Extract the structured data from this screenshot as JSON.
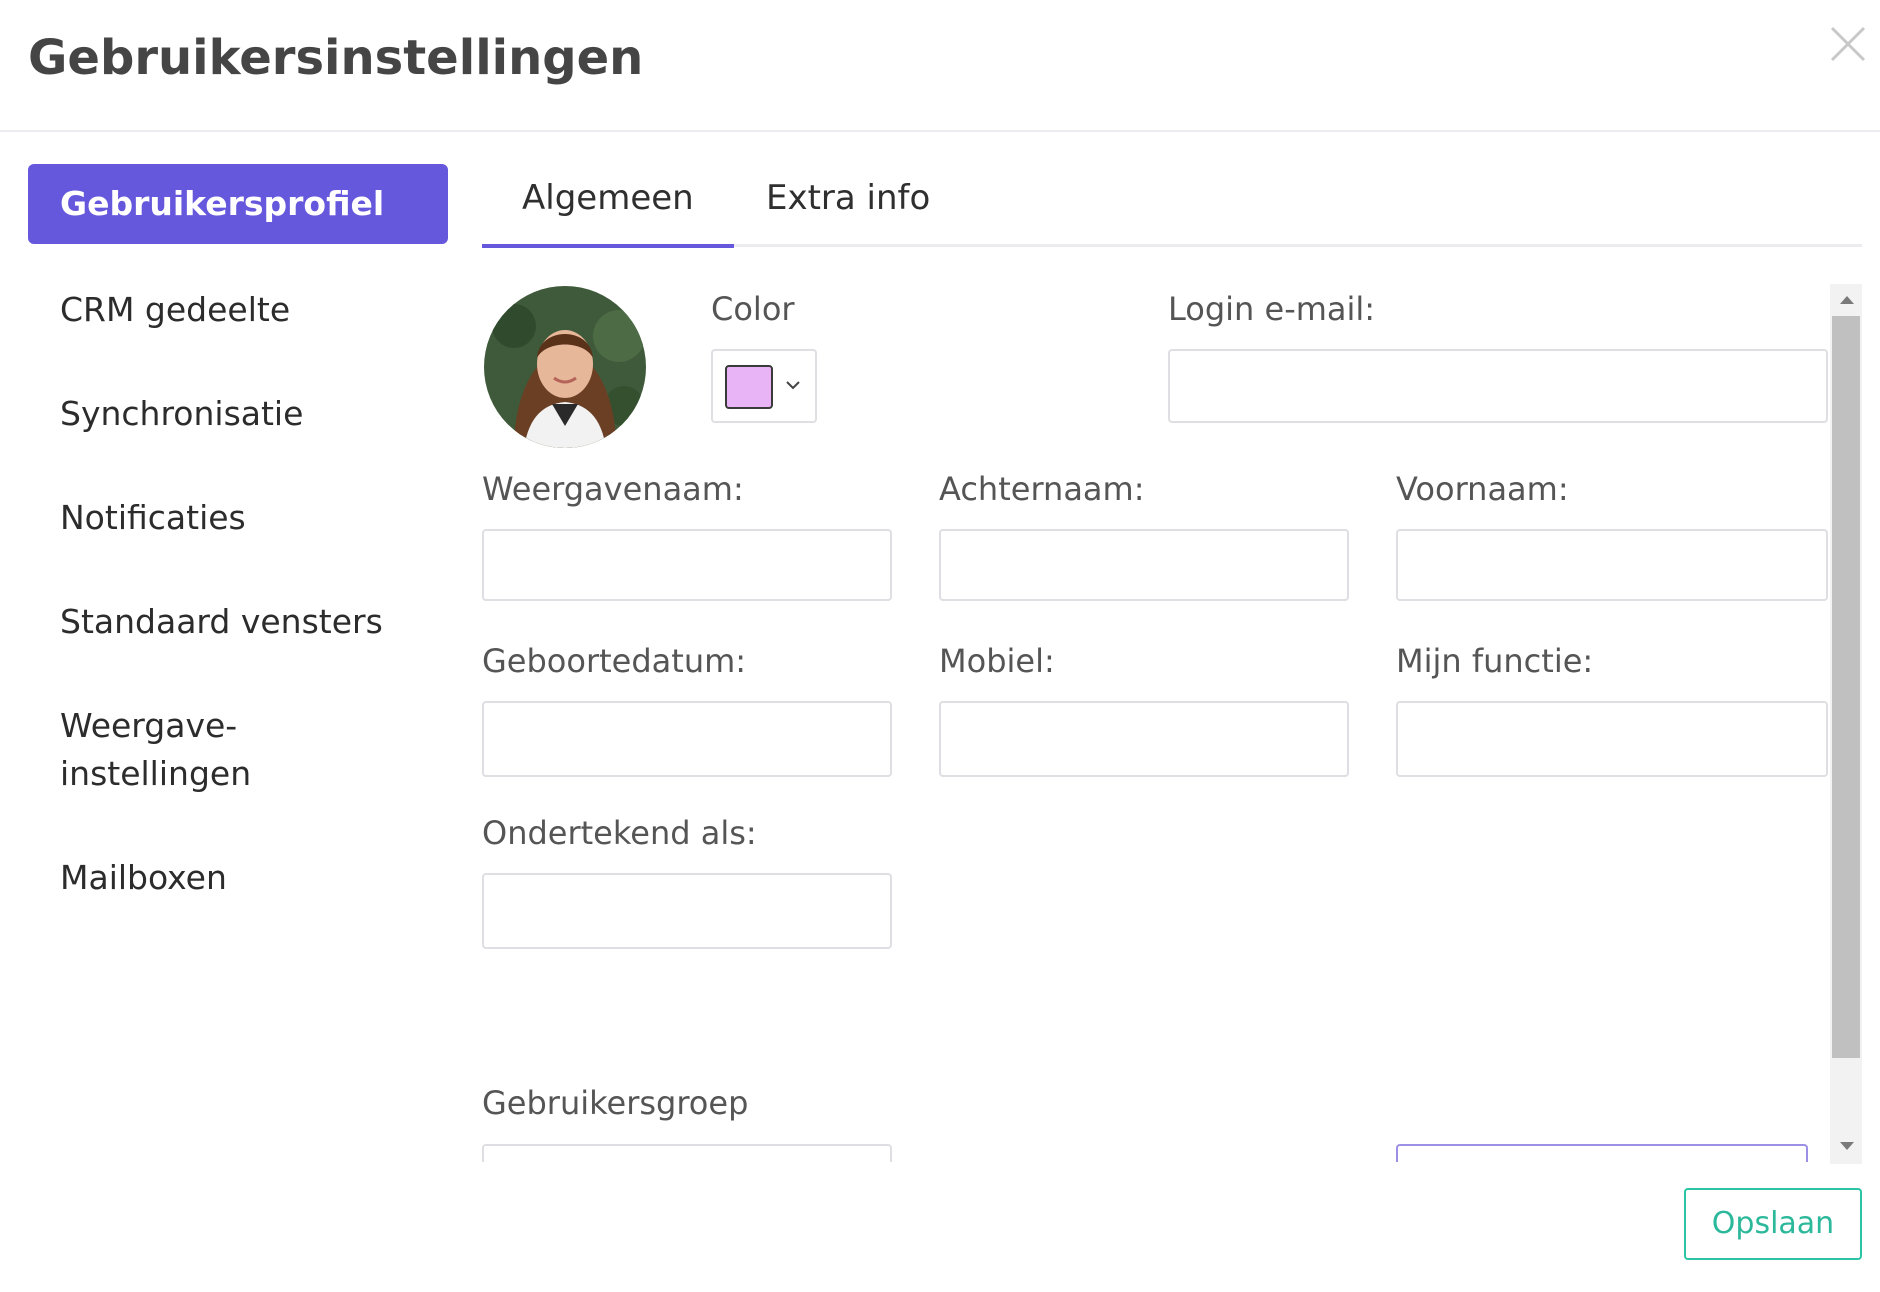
{
  "dialog": {
    "title": "Gebruikersinstellingen"
  },
  "sidebar": {
    "items": [
      {
        "label": "Gebruikersprofiel",
        "active": true
      },
      {
        "label": "CRM gedeelte"
      },
      {
        "label": "Synchronisatie"
      },
      {
        "label": "Notificaties"
      },
      {
        "label": "Standaard vensters"
      },
      {
        "label": "Weergave-\ninstellingen"
      },
      {
        "label": "Mailboxen"
      }
    ]
  },
  "tabs": [
    {
      "label": "Algemeen",
      "active": true
    },
    {
      "label": "Extra info"
    }
  ],
  "form": {
    "color_label": "Color",
    "color_value": "#e9b4f5",
    "login_email_label": "Login e-mail:",
    "login_email_value": "",
    "weergavenaam_label": "Weergavenaam:",
    "achternaam_label": "Achternaam:",
    "voornaam_label": "Voornaam:",
    "geboortedatum_label": "Geboortedatum:",
    "mobiel_label": "Mobiel:",
    "mijn_functie_label": "Mijn functie:",
    "ondertekend_als_label": "Ondertekend als:",
    "gebruikersgroep_label": "Gebruikersgroep"
  },
  "footer": {
    "save_label": "Opslaan"
  },
  "colors": {
    "accent": "#6658dc",
    "save": "#2cc4a5"
  }
}
